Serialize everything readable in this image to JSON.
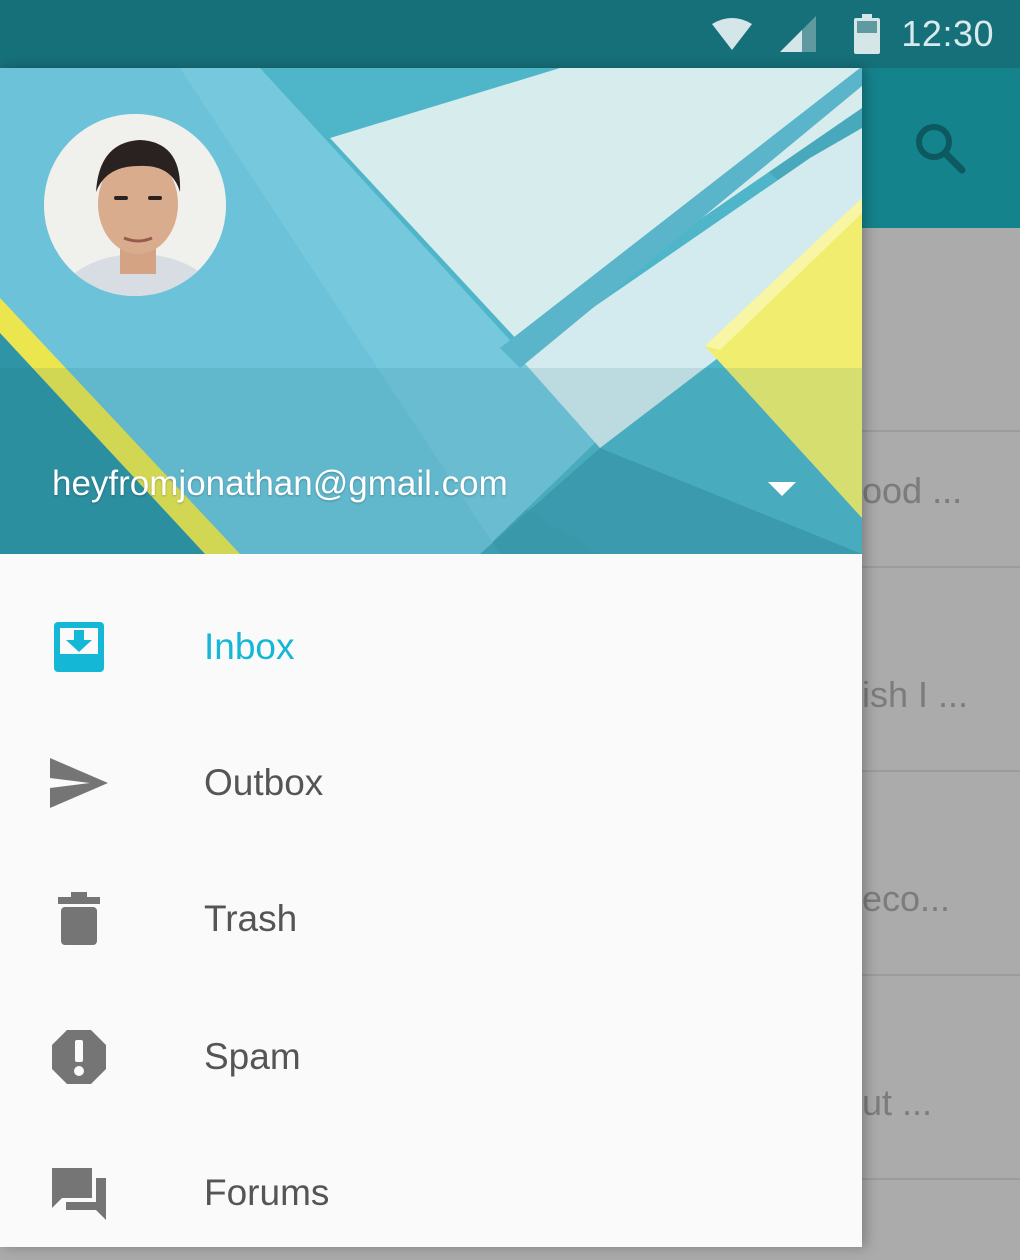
{
  "status_bar": {
    "time": "12:30",
    "icons": [
      "wifi-icon",
      "signal-icon",
      "battery-icon"
    ]
  },
  "app_bar": {
    "icons": [
      "search-icon"
    ]
  },
  "background_list": {
    "snippets": [
      "ood ...",
      "ish I ...",
      "eco...",
      "ut ..."
    ]
  },
  "drawer": {
    "account": {
      "email": "heyfromjonathan@gmail.com",
      "dropdown_icon": "arrow-drop-down-icon"
    },
    "items": [
      {
        "label": "Inbox",
        "icon": "inbox-icon",
        "active": true
      },
      {
        "label": "Outbox",
        "icon": "send-icon",
        "active": false
      },
      {
        "label": "Trash",
        "icon": "trash-icon",
        "active": false
      },
      {
        "label": "Spam",
        "icon": "report-icon",
        "active": false
      },
      {
        "label": "Forums",
        "icon": "forum-icon",
        "active": false
      }
    ]
  },
  "colors": {
    "status_bar": "#16707a",
    "toolbar": "#15838c",
    "accent": "#14b8d6",
    "icon_gray": "#757575",
    "scrim": "#ababab"
  }
}
